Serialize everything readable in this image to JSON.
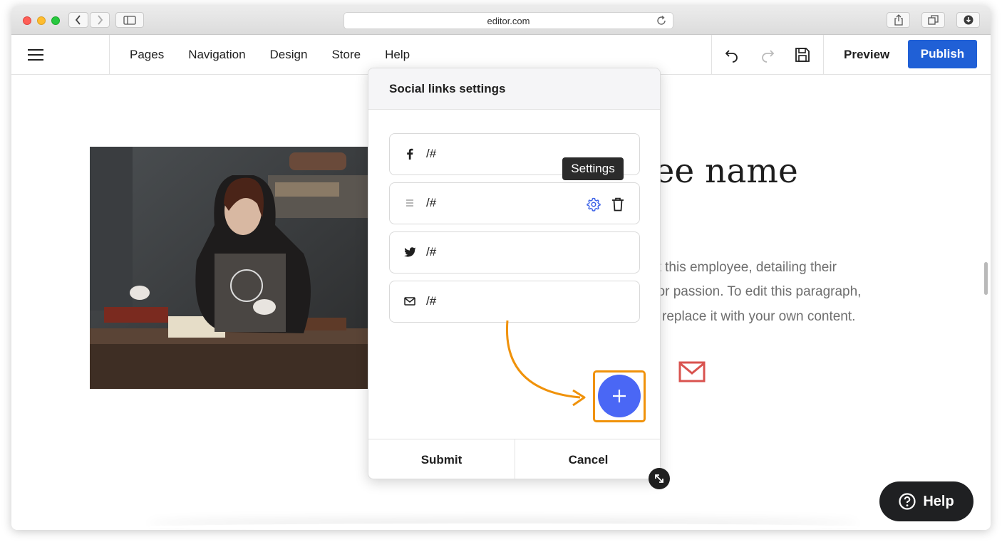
{
  "browser": {
    "url": "editor.com"
  },
  "header": {
    "nav": [
      "Pages",
      "Navigation",
      "Design",
      "Store",
      "Help"
    ],
    "preview_label": "Preview",
    "publish_label": "Publish"
  },
  "page": {
    "heading_fragment": "yee name",
    "paragraph_lines": [
      "ut this employee, detailing their",
      ", or passion. To edit this paragraph,",
      "replace it with your own content."
    ]
  },
  "modal": {
    "title": "Social links settings",
    "links": [
      {
        "icon": "facebook-icon",
        "value": "/#"
      },
      {
        "icon": "drag-handle-icon",
        "value": "/#"
      },
      {
        "icon": "twitter-icon",
        "value": "/#"
      },
      {
        "icon": "mail-icon",
        "value": "/#"
      }
    ],
    "tooltip": "Settings",
    "submit_label": "Submit",
    "cancel_label": "Cancel"
  },
  "help_label": "Help",
  "colors": {
    "publish": "#2060d6",
    "add_button": "#4a67f5",
    "highlight": "#f0920a",
    "mail_accent": "#d9534f"
  }
}
